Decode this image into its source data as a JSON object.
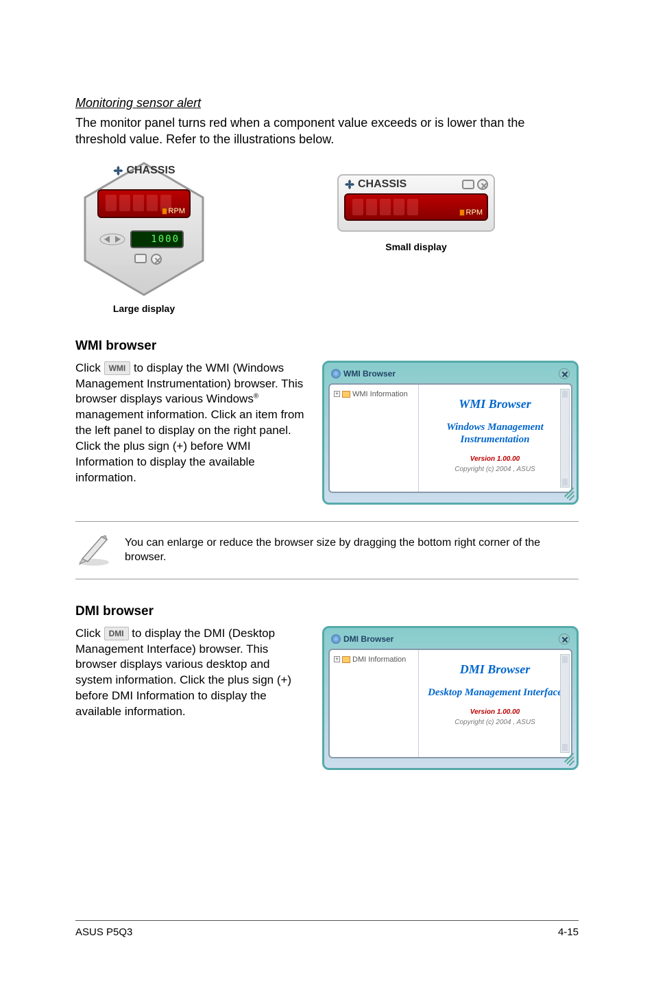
{
  "alert": {
    "title": "Monitoring sensor alert",
    "body": "The monitor panel turns red when a component value exceeds or is lower than the threshold value. Refer to the illustrations below."
  },
  "displays": {
    "large_caption": "Large display",
    "small_caption": "Small display",
    "panel_title": "CHASSIS",
    "rpm_label": "RPM",
    "threshold_value": "1000"
  },
  "wmi": {
    "heading": "WMI browser",
    "para_pre": "Click ",
    "btn_label": "WMI",
    "para_post1": " to display the WMI (Windows Management Instrumentation) browser. This browser displays various Windows",
    "para_post2": " management information. Click an item from the left panel to display on the right panel. Click the plus sign (+) before WMI Information to display the available information.",
    "panel_title": "WMI Browser",
    "tree_root": "WMI Information",
    "content_title": "WMI  Browser",
    "content_sub": "Windows Management Instrumentation",
    "version": "Version 1.00.00",
    "copyright": "Copyright (c) 2004 ,  ASUS"
  },
  "note": {
    "text": "You can enlarge or reduce the browser size by dragging the bottom right corner of the browser."
  },
  "dmi": {
    "heading": "DMI browser",
    "para_pre": "Click ",
    "btn_label": "DMI",
    "para_post": " to display the DMI (Desktop Management Interface) browser. This browser displays various desktop and system information. Click the plus sign (+) before DMI Information to display the available information.",
    "panel_title": "DMI Browser",
    "tree_root": "DMI Information",
    "content_title": "DMI  Browser",
    "content_sub": "Desktop Management Interface",
    "version": "Version 1.00.00",
    "copyright": "Copyright (c) 2004 ,  ASUS"
  },
  "footer": {
    "left": "ASUS P5Q3",
    "right": "4-15"
  }
}
